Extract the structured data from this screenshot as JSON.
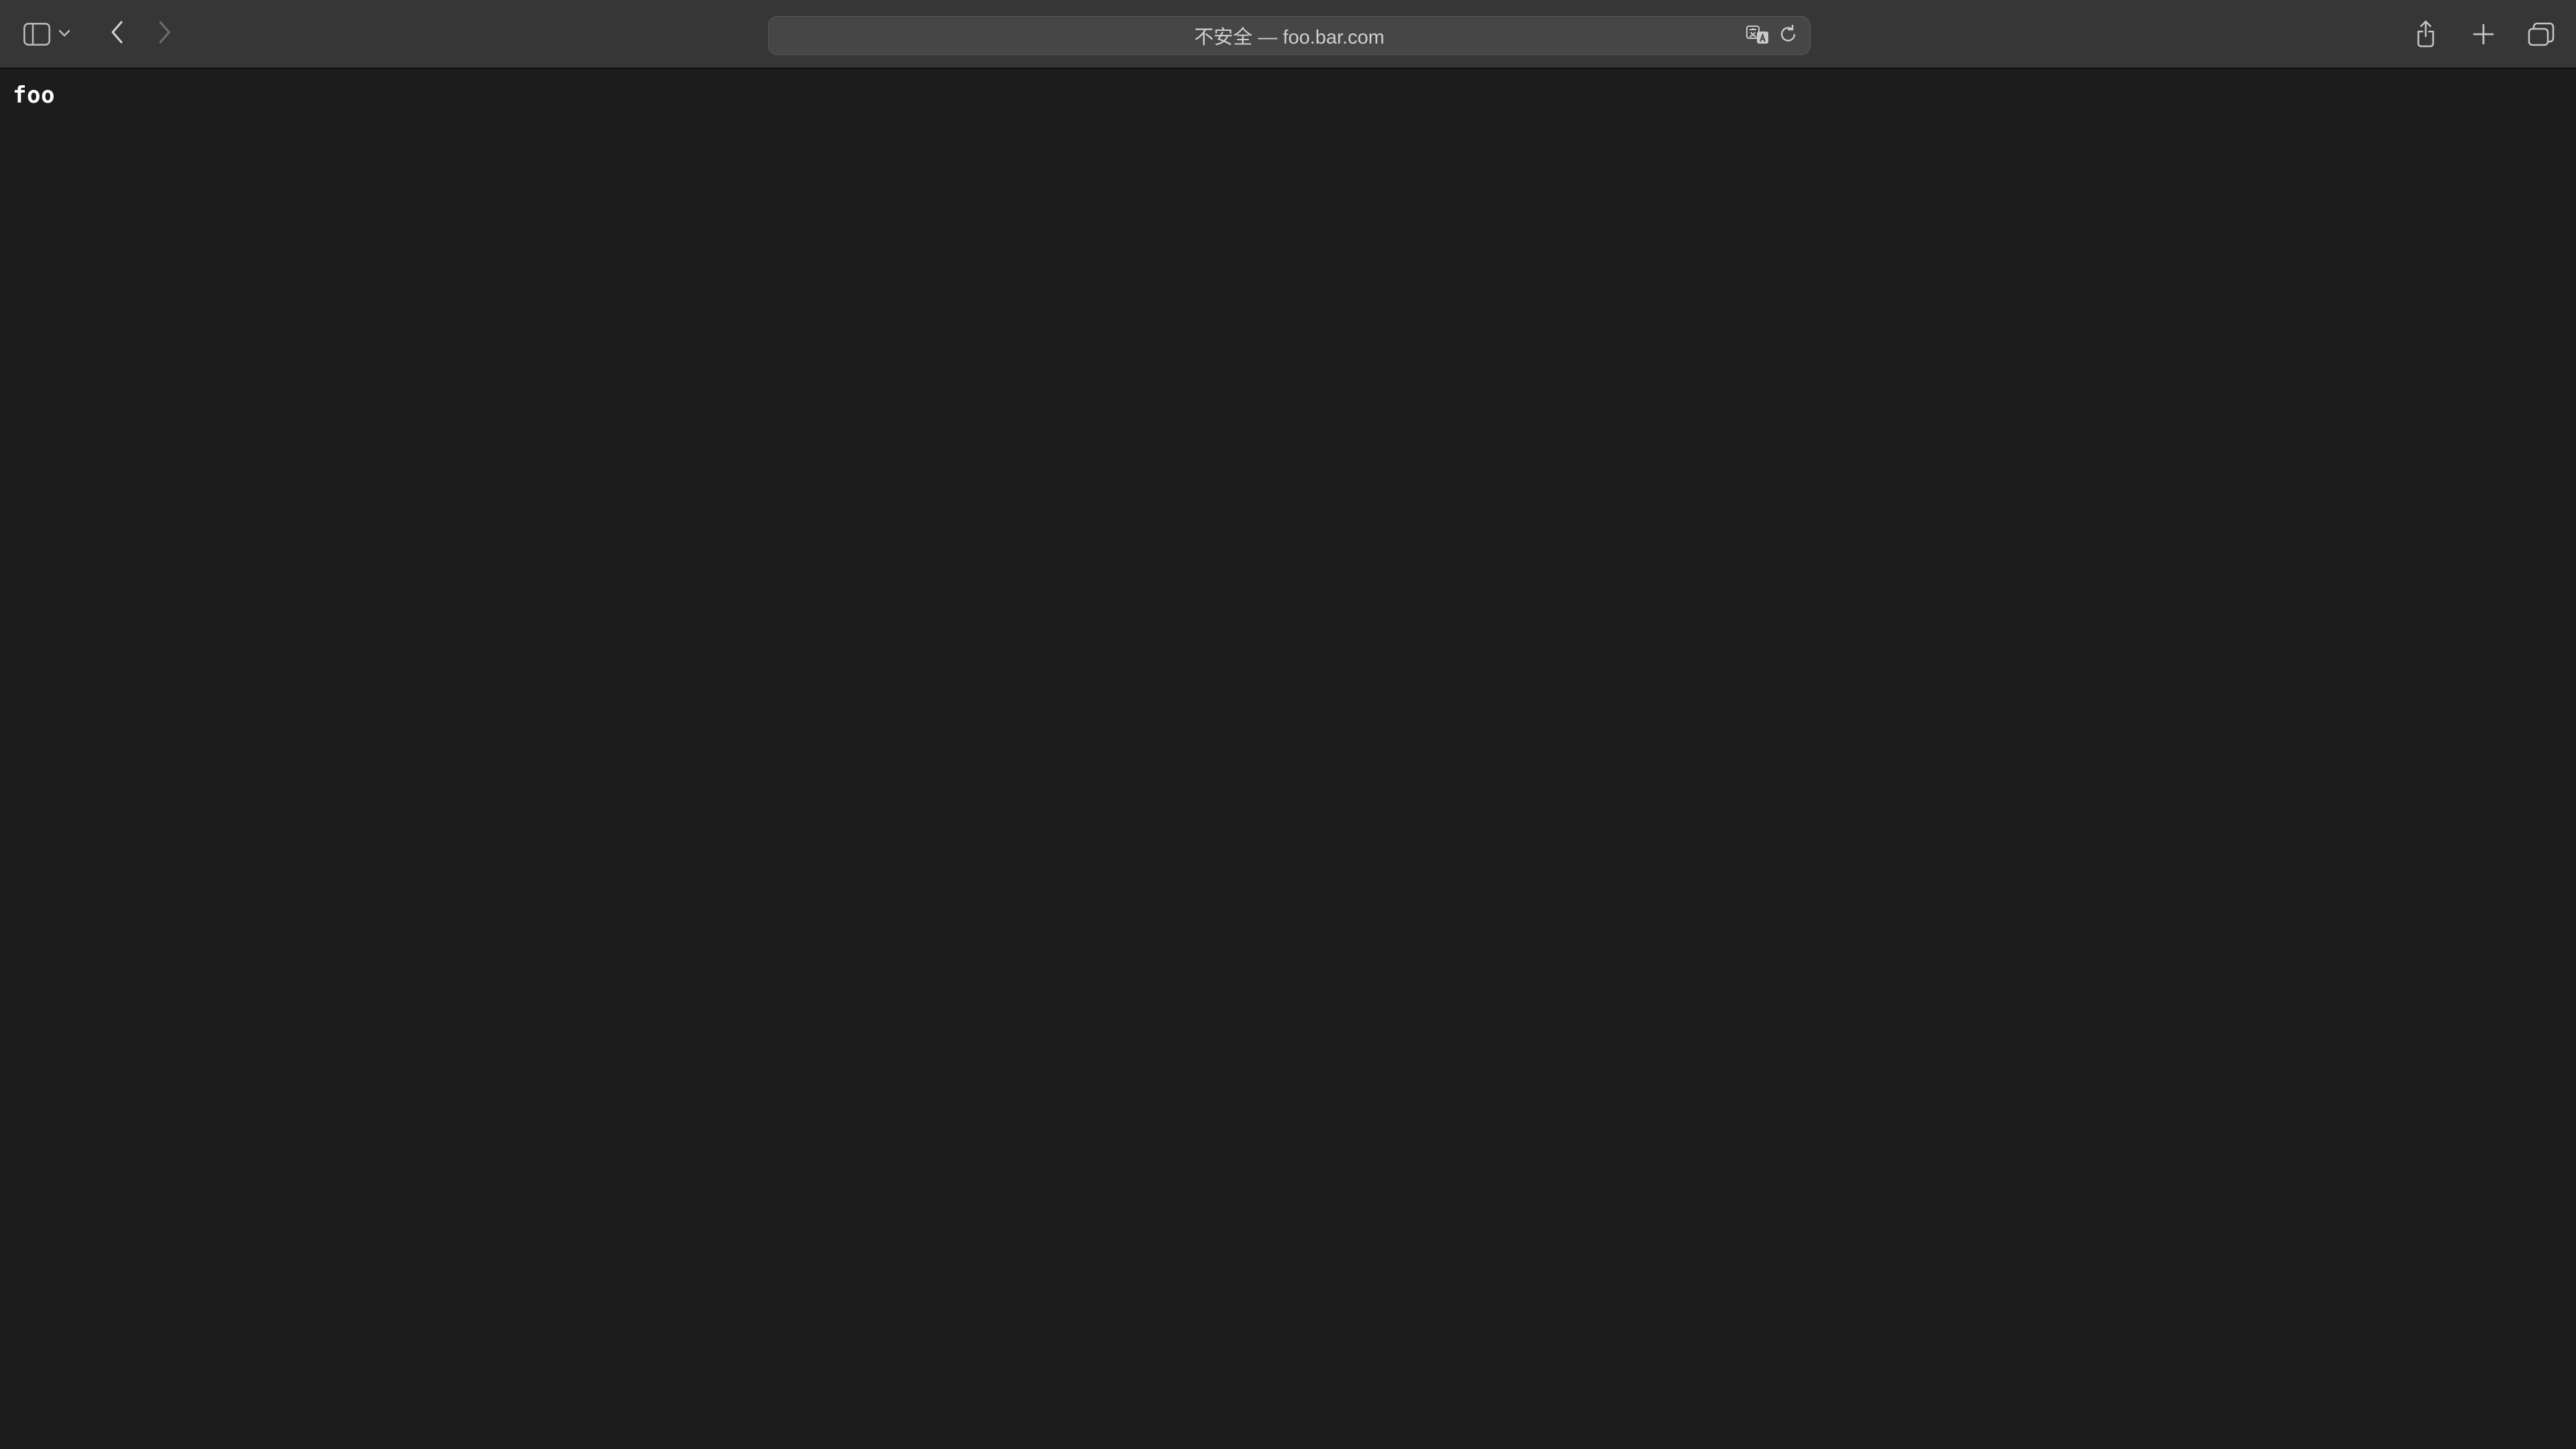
{
  "toolbar": {
    "address_prefix": "不安全 — ",
    "address_domain": "foo.bar.com"
  },
  "page": {
    "body_text": "foo"
  }
}
